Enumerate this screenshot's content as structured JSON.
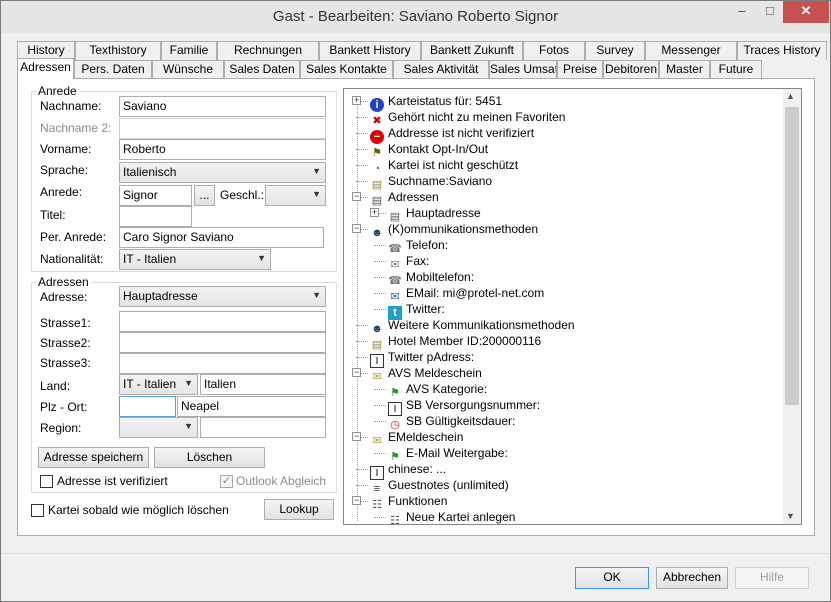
{
  "window": {
    "title": "Gast - Bearbeiten: Saviano Roberto Signor",
    "minimize": "–",
    "maximize": "□",
    "close": "✕"
  },
  "tabs_row1": [
    "History",
    "Texthistory",
    "Familie",
    "Rechnungen",
    "Bankett History",
    "Bankett Zukunft",
    "Fotos",
    "Survey",
    "Messenger",
    "Traces History"
  ],
  "tabs_row2": [
    "Adressen",
    "Pers. Daten",
    "Wünsche",
    "Sales Daten",
    "Sales Kontakte",
    "Sales Aktivität",
    "Sales Umsatz",
    "Preise",
    "Debitoren",
    "Master",
    "Future"
  ],
  "anrede": {
    "caption": "Anrede",
    "nachname_label": "Nachname:",
    "nachname": "Saviano",
    "nachname2_label": "Nachname 2:",
    "nachname2": "",
    "vorname_label": "Vorname:",
    "vorname": "Roberto",
    "sprache_label": "Sprache:",
    "sprache": "Italienisch",
    "anrede_label": "Anrede:",
    "anrede": "Signor",
    "anrede_btn": "...",
    "geschl_label": "Geschl.:",
    "geschl": "",
    "titel_label": "Titel:",
    "titel": "",
    "per_anrede_label": "Per. Anrede:",
    "per_anrede": "Caro Signor Saviano",
    "nationalitaet_label": "Nationalität:",
    "nationalitaet": "IT - Italien"
  },
  "adressen": {
    "caption": "Adressen",
    "adresse_label": "Adresse:",
    "adresse": "Hauptadresse",
    "strasse1_label": "Strasse1:",
    "strasse1": "",
    "strasse2_label": "Strasse2:",
    "strasse2": "",
    "strasse3_label": "Strasse3:",
    "strasse3": "",
    "land_label": "Land:",
    "land_code": "IT - Italien",
    "land_name": "Italien",
    "plz_label": "Plz - Ort:",
    "plz": "",
    "ort": "Neapel",
    "region_label": "Region:",
    "region": "",
    "region_text": "",
    "save_btn": "Adresse speichern",
    "delete_btn": "Löschen",
    "verified_label": "Adresse ist verifiziert",
    "outlook_label": "Outlook Abgleich",
    "outlook_check": "✓"
  },
  "delete_asap_label": "Kartei sobald wie möglich löschen",
  "lookup_btn": "Lookup",
  "tree": [
    {
      "text": "Karteistatus für: 5451",
      "icon": "info-icon",
      "glyph": "i",
      "color": "#1f3fd0"
    },
    {
      "text": "Gehört nicht zu meinen Favoriten",
      "icon": "x-mark-icon",
      "glyph": "✖",
      "color": "#d00000"
    },
    {
      "text": "Addresse ist nicht verifiziert",
      "icon": "no-entry-icon",
      "glyph": "−",
      "color": "#e00000"
    },
    {
      "text": "Kontakt Opt-In/Out",
      "icon": "person-key-icon",
      "glyph": "⚑",
      "color": "#6a5a00"
    },
    {
      "text": "Kartei ist nicht geschützt",
      "icon": "lock-open-icon",
      "glyph": "◔",
      "color": "#2d8a2d"
    },
    {
      "text": "Suchname:Saviano",
      "icon": "card-stack-icon",
      "glyph": "▤",
      "color": "#8a8a3a"
    },
    {
      "text": "Adressen",
      "icon": "address-card-icon",
      "glyph": "▤",
      "color": "#555"
    },
    {
      "text": "Hauptadresse",
      "icon": "address-card-icon",
      "glyph": "▤",
      "color": "#555"
    },
    {
      "text": "(K)ommunikationsmethoden",
      "icon": "contacts-icon",
      "glyph": "☻",
      "color": "#1a3a70"
    },
    {
      "text": "Telefon:",
      "icon": "phone-icon",
      "glyph": "☎",
      "color": "#777"
    },
    {
      "text": "Fax:",
      "icon": "fax-icon",
      "glyph": "✉",
      "color": "#777"
    },
    {
      "text": "Mobiltelefon:",
      "icon": "mobile-icon",
      "glyph": "☎",
      "color": "#777"
    },
    {
      "text": "EMail: mi@protel-net.com",
      "icon": "email-icon",
      "glyph": "✉",
      "color": "#2a5db0"
    },
    {
      "text": "Twitter:",
      "icon": "twitter-icon",
      "glyph": "t",
      "color": "#ffffff"
    },
    {
      "text": "Weitere Kommunikationsmethoden",
      "icon": "contacts-icon",
      "glyph": "☻",
      "color": "#1a3a70"
    },
    {
      "text": "Hotel Member ID:200000116",
      "icon": "card-stack-icon",
      "glyph": "▤",
      "color": "#8a8a3a"
    },
    {
      "text": "Twitter pAdress:",
      "icon": "text-field-icon",
      "glyph": "I",
      "color": "#000"
    },
    {
      "text": "AVS Meldeschein",
      "icon": "envelope-open-icon",
      "glyph": "✉",
      "color": "#b8a030"
    },
    {
      "text": "AVS Kategorie:",
      "icon": "flag-icon",
      "glyph": "⚑",
      "color": "#2a9a2a"
    },
    {
      "text": "SB Versorgungsnummer:",
      "icon": "text-field-icon",
      "glyph": "I",
      "color": "#000"
    },
    {
      "text": "SB Gültigkeitsdauer:",
      "icon": "clock-icon",
      "glyph": "◷",
      "color": "#d02020"
    },
    {
      "text": "EMeldeschein",
      "icon": "envelope-open-icon",
      "glyph": "✉",
      "color": "#b8a030"
    },
    {
      "text": "E-Mail Weitergabe:",
      "icon": "flag-icon",
      "glyph": "⚑",
      "color": "#2a9a2a"
    },
    {
      "text": "chinese:  ...",
      "icon": "text-field-icon",
      "glyph": "I",
      "color": "#000"
    },
    {
      "text": "Guestnotes (unlimited)",
      "icon": "notes-icon",
      "glyph": "≡",
      "color": "#333"
    },
    {
      "text": "Funktionen",
      "icon": "network-icon",
      "glyph": "☷",
      "color": "#555"
    },
    {
      "text": "Neue Kartei anlegen",
      "icon": "network-icon",
      "glyph": "☷",
      "color": "#555"
    }
  ],
  "footer": {
    "ok": "OK",
    "cancel": "Abbrechen",
    "help": "Hilfe"
  }
}
